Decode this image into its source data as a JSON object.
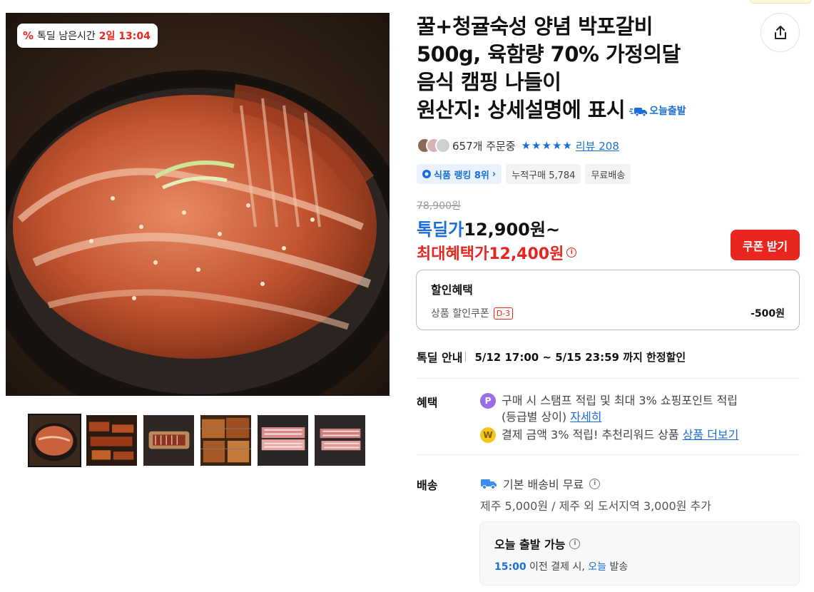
{
  "gallery": {
    "timer": {
      "label": "톡딜 남은시간",
      "value": "2일 13:04"
    },
    "thumbnails": [
      "thumb-1",
      "thumb-2",
      "thumb-3",
      "thumb-4",
      "thumb-5",
      "thumb-6"
    ],
    "active_thumbnail": 0
  },
  "product": {
    "title_lines": [
      "꿀+청귤숙성 양념 박포갈비",
      "500g, 육함량 70% 가정의달",
      "음식 캠핑 나들이",
      "원산지: 상세설명에 표시"
    ],
    "today_ship_tag": "오늘출발",
    "order_count": "657개 주문중",
    "stars": "★★★★★",
    "review_text": "리뷰 208",
    "chips": {
      "rank": "식품 랭킹 8위",
      "cumulative": "누적구매 5,784",
      "free_ship": "무료배송"
    }
  },
  "price": {
    "original": "78,900원",
    "deal_label": "톡딜가",
    "deal_value": "12,900원~",
    "max_label": "최대혜택가",
    "max_value": "12,400원",
    "coupon_button": "쿠폰 받기"
  },
  "discount": {
    "title": "할인혜택",
    "item_label": "상품 할인쿠폰",
    "item_tag": "D-3",
    "item_amount": "-500원"
  },
  "deal_info": {
    "label": "톡딜 안내",
    "value": "5/12 17:00 ~ 5/15 23:59 까지 한정할인"
  },
  "benefits": {
    "label": "혜택",
    "line1": "구매 시 스탬프 적립 및 최대 3% 쇼핑포인트 적립",
    "line1b": "(등급별 상이)",
    "line1_link": "자세히",
    "line2": "결제 금액 3% 적립! 추천리워드 상품",
    "line2_link": "상품 더보기",
    "coin1": "P",
    "coin2": "W"
  },
  "shipping": {
    "label": "배송",
    "base": "기본 배송비 무료",
    "extra": "제주 5,000원 / 제주 외 도서지역 3,000원 추가",
    "today_title": "오늘 출발 가능",
    "today_time": "15:00",
    "today_mid": "이전 결제 시,",
    "today_word": "오늘",
    "today_end": "발송"
  },
  "colors": {
    "accent_blue": "#1a6ed8",
    "accent_red": "#e8261f"
  }
}
